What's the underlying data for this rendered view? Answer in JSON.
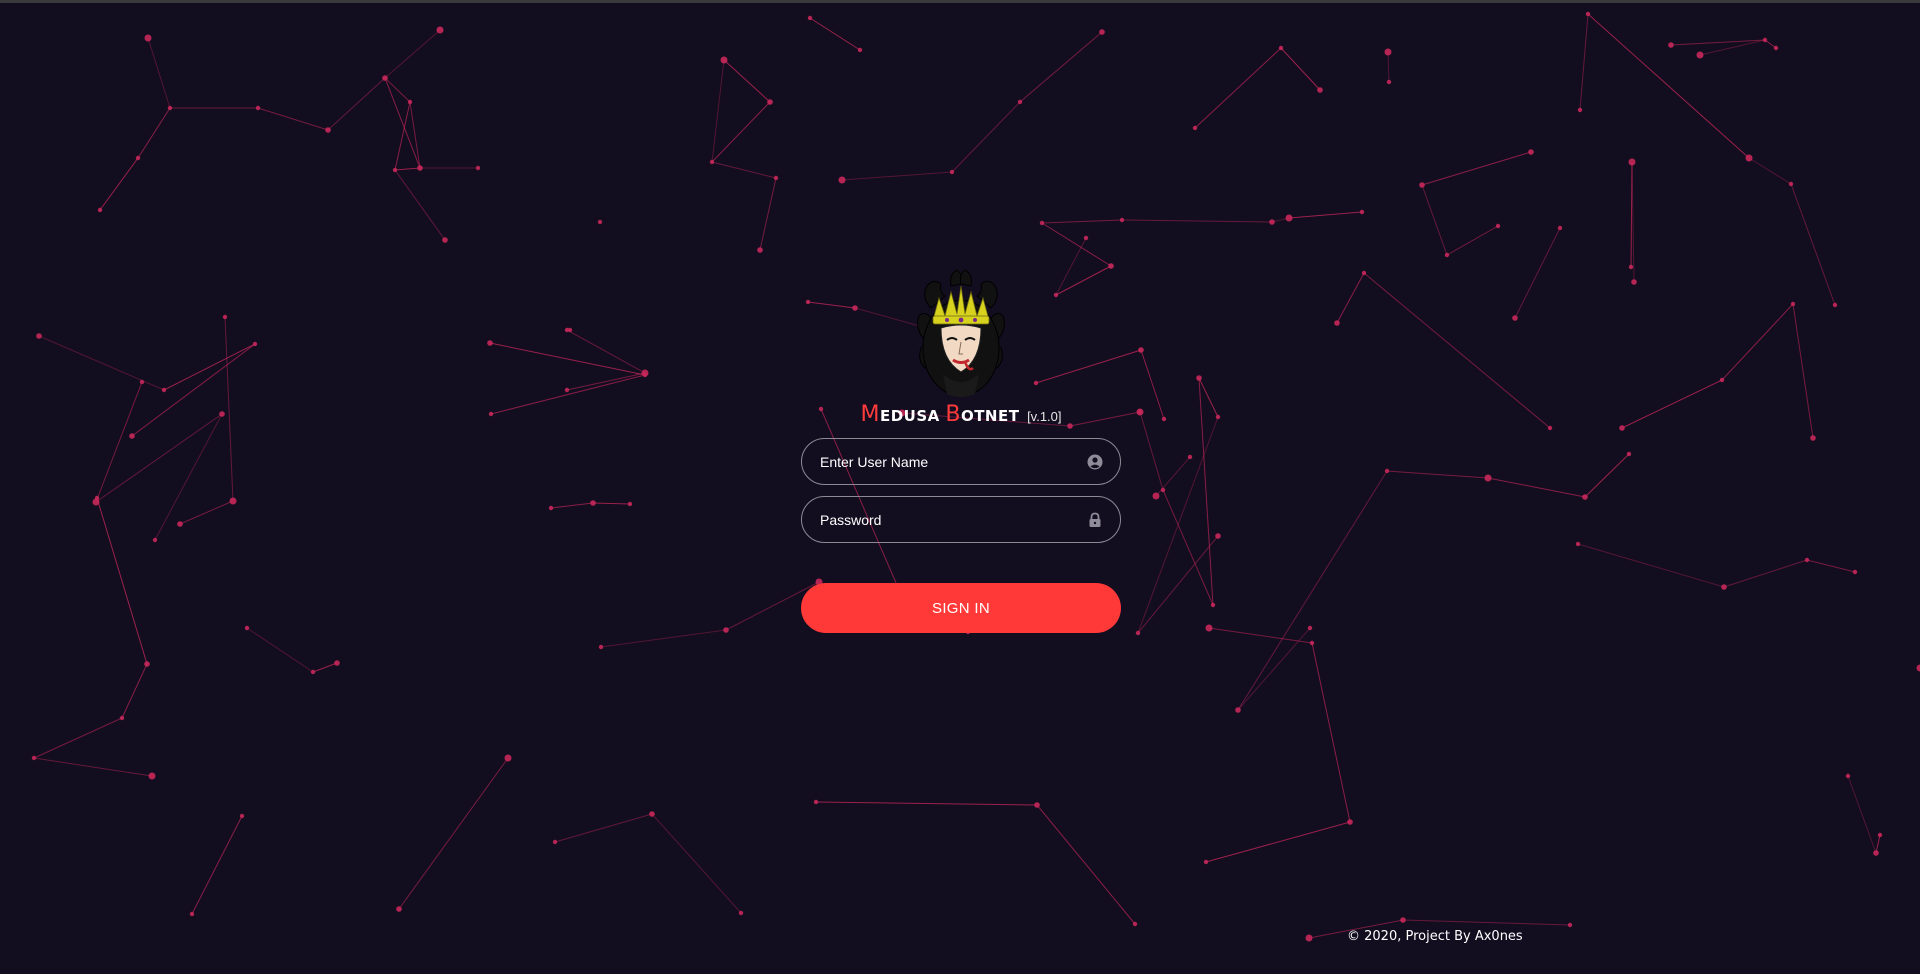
{
  "brand": {
    "word1_cap": "M",
    "word1_rest": "edusa",
    "word2_cap": "B",
    "word2_rest": "otnet",
    "version": "[v.1.0]"
  },
  "login": {
    "username_placeholder": "Enter User Name",
    "password_placeholder": "Password",
    "signin_label": "SIGN IN"
  },
  "icons": {
    "username": "user-circle-icon",
    "password": "lock-icon",
    "logo": "medusa-head-logo"
  },
  "colors": {
    "background": "#130d20",
    "accent": "#ff3838",
    "particles": "#c8285a"
  },
  "footer": {
    "text": "© 2020, Project By Ax0nes"
  }
}
